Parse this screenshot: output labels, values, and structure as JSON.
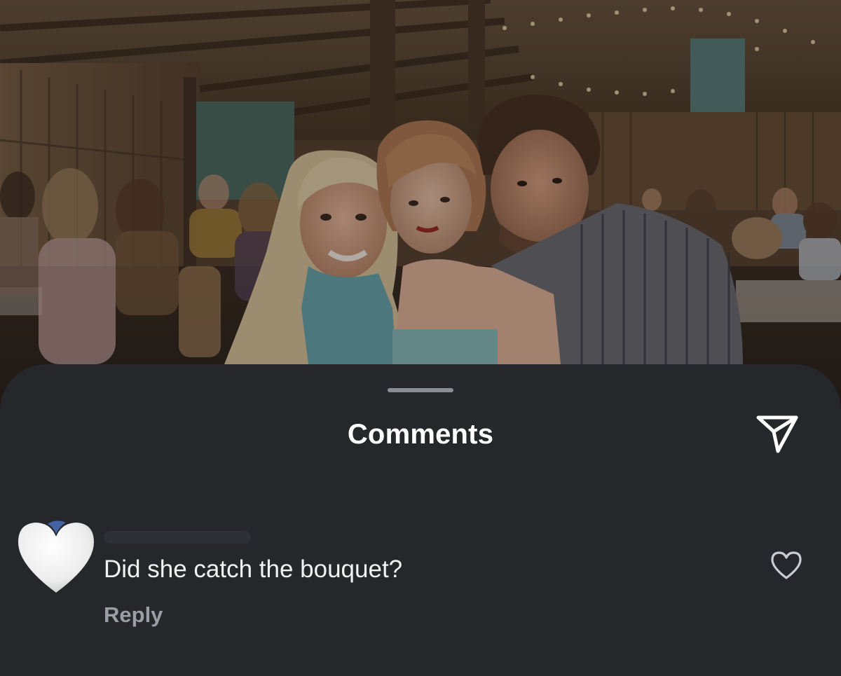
{
  "background": {
    "description_icon": "photo-backdrop"
  },
  "sheet": {
    "title": "Comments",
    "share_icon": "paper-plane-icon"
  },
  "comments": [
    {
      "avatar_icon": "white-heart-icon",
      "text": "Did she catch the bouquet?",
      "reply_label": "Reply",
      "like_icon": "heart-outline-icon"
    }
  ],
  "colors": {
    "sheet_bg": "#25272b",
    "text_primary": "#f2f2f2",
    "text_secondary": "#9a9ea4",
    "grabber": "#8a8d92"
  }
}
